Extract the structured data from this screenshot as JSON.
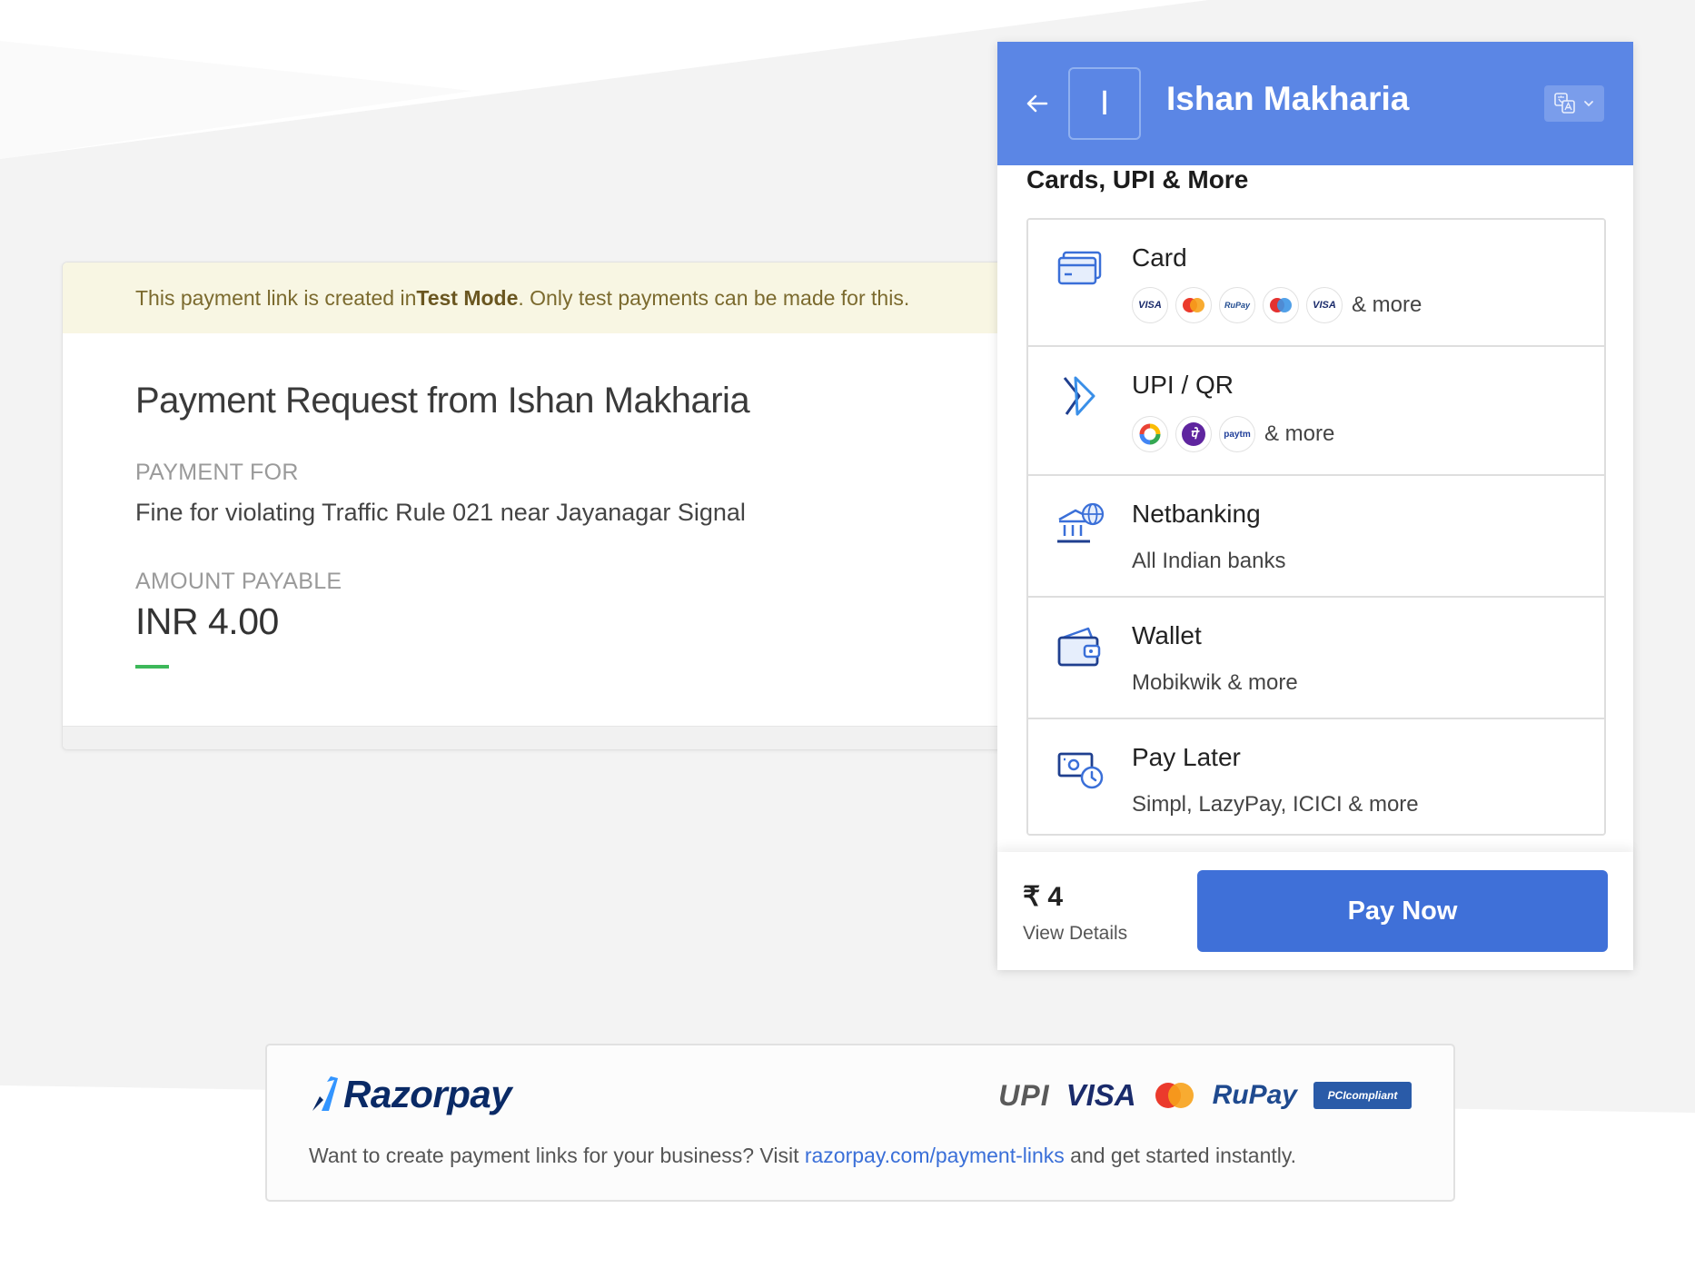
{
  "request": {
    "banner_prefix": "This payment link is created in ",
    "banner_mode": "Test Mode",
    "banner_suffix": ". Only test payments can be made for this.",
    "title": "Payment Request from Ishan Makharia",
    "payment_for_label": "PAYMENT FOR",
    "payment_for_value": "Fine for violating Traffic Rule 021 near Jayanagar Signal",
    "amount_label": "AMOUNT PAYABLE",
    "amount_value": "INR 4.00"
  },
  "checkout": {
    "merchant_initial": "I",
    "merchant_name": "Ishan Makharia",
    "section_title": "Cards, UPI & More",
    "methods": [
      {
        "name": "Card",
        "more": "& more",
        "icon": "card-icon",
        "logos": [
          "VISA",
          "Mastercard",
          "RuPay",
          "Maestro",
          "VISA"
        ]
      },
      {
        "name": "UPI / QR",
        "more": "& more",
        "icon": "upi-icon",
        "logos": [
          "Google Pay",
          "PhonePe",
          "Paytm"
        ]
      },
      {
        "name": "Netbanking",
        "subtitle": "All Indian banks",
        "icon": "bank-icon"
      },
      {
        "name": "Wallet",
        "subtitle": "Mobikwik & more",
        "icon": "wallet-icon"
      },
      {
        "name": "Pay Later",
        "subtitle": "Simpl, LazyPay, ICICI & more",
        "icon": "pay-later-icon"
      }
    ],
    "total": "₹ 4",
    "view_details": "View Details",
    "pay_button": "Pay Now",
    "header_color": "#5b86e5",
    "button_color": "#3f70d8"
  },
  "footer": {
    "brand": "Razorpay",
    "badges": {
      "upi": "UPI",
      "visa": "VISA",
      "rupay": "RuPay",
      "pci": "PCIcompliant"
    },
    "text_prefix": "Want to create payment links for your business? Visit ",
    "link_text": "razorpay.com/payment-links",
    "text_suffix": " and get started instantly."
  }
}
